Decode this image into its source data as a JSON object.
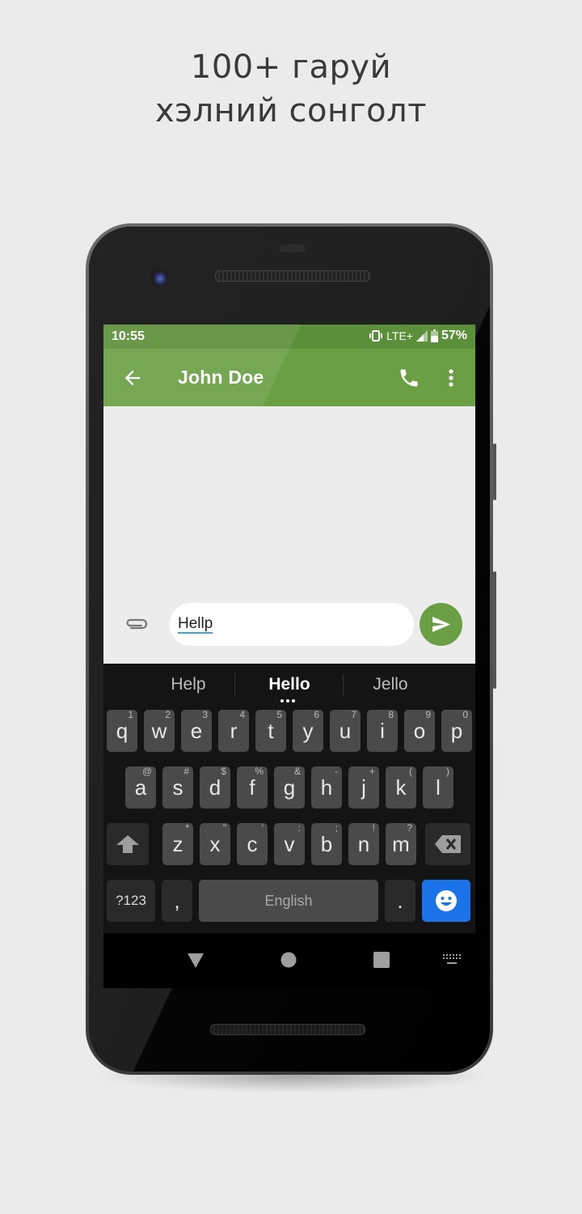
{
  "headline": {
    "line1": "100+ гаруй",
    "line2": "хэлний сонголт"
  },
  "status_bar": {
    "time": "10:55",
    "network": "LTE+",
    "battery_percent": "57%",
    "icons": [
      "vibrate-icon",
      "signal-icon",
      "battery-icon"
    ]
  },
  "app_bar": {
    "title": "John Doe",
    "back_icon": "arrow-left-icon",
    "call_icon": "phone-icon",
    "more_icon": "more-vert-icon"
  },
  "composer": {
    "attach_icon": "paperclip-icon",
    "input_value": "Hellp",
    "send_icon": "send-icon"
  },
  "colors": {
    "accent": "#6aa043",
    "status_bar": "#5c8f39",
    "emoji_key": "#1a73e8",
    "underline": "#3aa7d6"
  },
  "keyboard": {
    "suggestions": [
      "Help",
      "Hello",
      "Jello"
    ],
    "row1": [
      {
        "k": "q",
        "h": "1"
      },
      {
        "k": "w",
        "h": "2"
      },
      {
        "k": "e",
        "h": "3"
      },
      {
        "k": "r",
        "h": "4"
      },
      {
        "k": "t",
        "h": "5"
      },
      {
        "k": "y",
        "h": "6"
      },
      {
        "k": "u",
        "h": "7"
      },
      {
        "k": "i",
        "h": "8"
      },
      {
        "k": "o",
        "h": "9"
      },
      {
        "k": "p",
        "h": "0"
      }
    ],
    "row2": [
      {
        "k": "a",
        "h": "@"
      },
      {
        "k": "s",
        "h": "#"
      },
      {
        "k": "d",
        "h": "$"
      },
      {
        "k": "f",
        "h": "%"
      },
      {
        "k": "g",
        "h": "&"
      },
      {
        "k": "h",
        "h": "-"
      },
      {
        "k": "j",
        "h": "+"
      },
      {
        "k": "k",
        "h": "("
      },
      {
        "k": "l",
        "h": ")"
      }
    ],
    "row3": [
      {
        "k": "z",
        "h": "*"
      },
      {
        "k": "x",
        "h": "\""
      },
      {
        "k": "c",
        "h": "'"
      },
      {
        "k": "v",
        "h": ":"
      },
      {
        "k": "b",
        "h": ";"
      },
      {
        "k": "n",
        "h": "!"
      },
      {
        "k": "m",
        "h": "?"
      }
    ],
    "symbols_label": "?123",
    "comma": ",",
    "space_label": "English",
    "period": "."
  },
  "nav_bar": {
    "icons": [
      "back-triangle-icon",
      "home-circle-icon",
      "recents-square-icon",
      "keyboard-switch-icon"
    ]
  }
}
